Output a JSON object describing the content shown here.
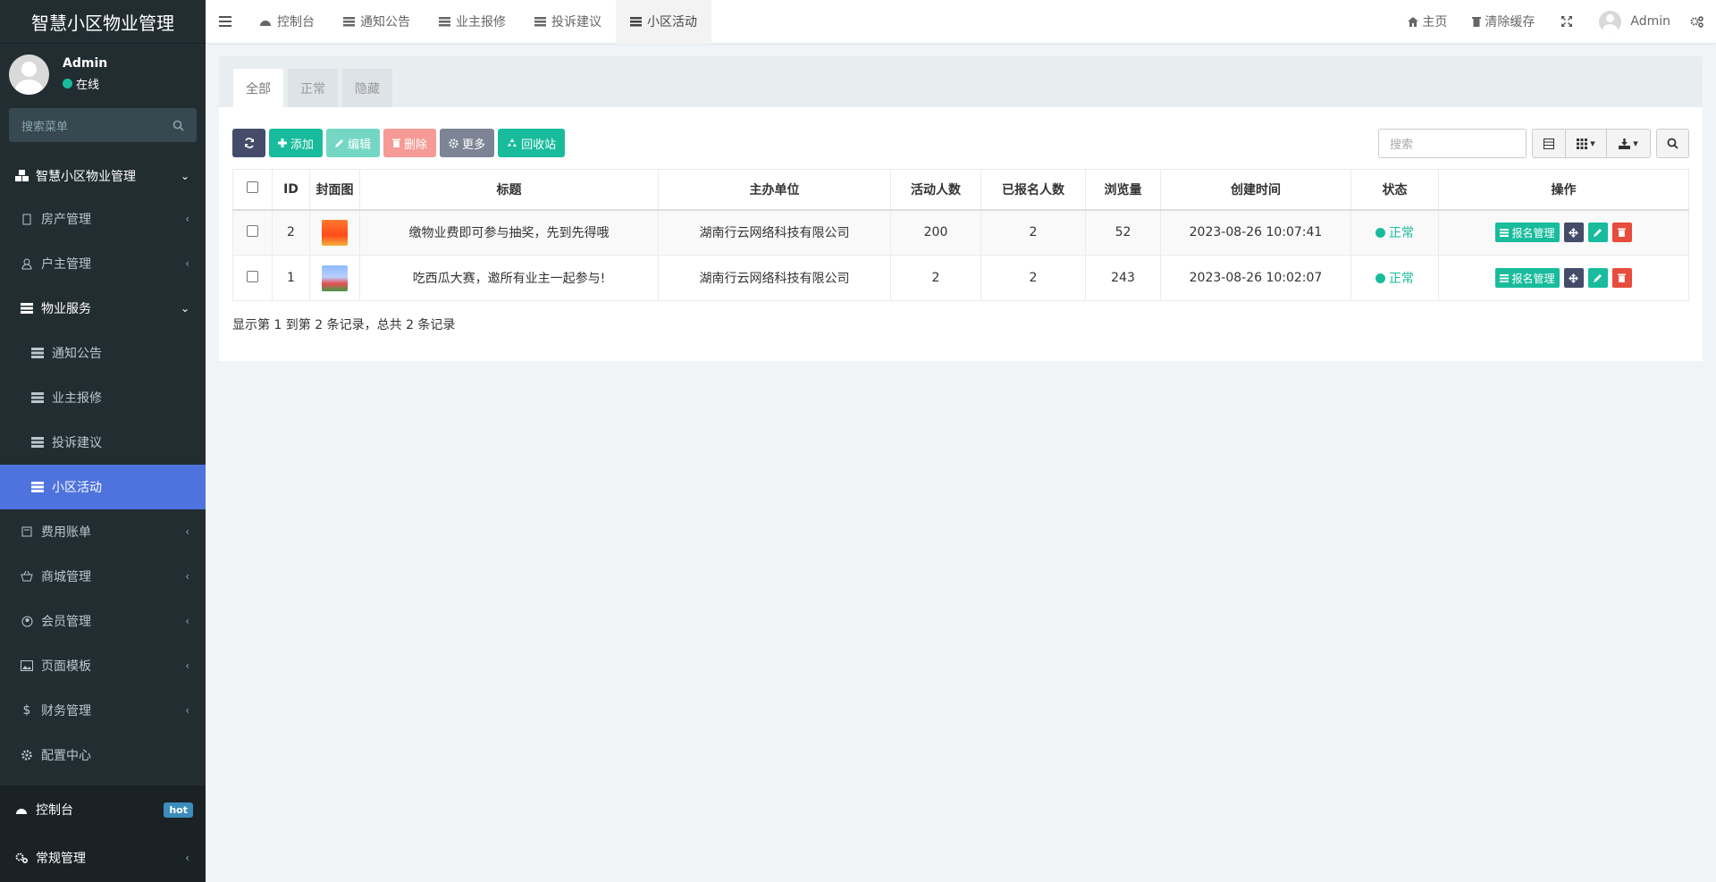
{
  "app": {
    "title": "智慧小区物业管理"
  },
  "user": {
    "name": "Admin",
    "status": "在线"
  },
  "sidebar": {
    "search_placeholder": "搜索菜单",
    "root_label": "智慧小区物业管理",
    "items": [
      {
        "label": "房产管理",
        "icon": "building-icon"
      },
      {
        "label": "户主管理",
        "icon": "user-icon"
      },
      {
        "label": "物业服务",
        "icon": "list-icon"
      },
      {
        "label": "通知公告",
        "icon": "list-icon"
      },
      {
        "label": "业主报修",
        "icon": "list-icon"
      },
      {
        "label": "投诉建议",
        "icon": "list-icon"
      },
      {
        "label": "小区活动",
        "icon": "list-icon"
      },
      {
        "label": "费用账单",
        "icon": "bill-icon"
      },
      {
        "label": "商城管理",
        "icon": "basket-icon"
      },
      {
        "label": "会员管理",
        "icon": "member-icon"
      },
      {
        "label": "页面模板",
        "icon": "image-icon"
      },
      {
        "label": "财务管理",
        "icon": "dollar-icon"
      },
      {
        "label": "配置中心",
        "icon": "gear-icon"
      }
    ],
    "bottom": [
      {
        "label": "控制台",
        "badge": "hot",
        "icon": "dashboard-icon"
      },
      {
        "label": "常规管理",
        "icon": "cogs-icon"
      }
    ]
  },
  "topnav": {
    "tabs": [
      {
        "label": "控制台",
        "icon": "dashboard-icon"
      },
      {
        "label": "通知公告",
        "icon": "list-icon"
      },
      {
        "label": "业主报修",
        "icon": "list-icon"
      },
      {
        "label": "投诉建议",
        "icon": "list-icon"
      },
      {
        "label": "小区活动",
        "icon": "list-icon",
        "active": true
      }
    ],
    "home": "主页",
    "clear_cache": "清除缓存",
    "user": "Admin"
  },
  "panel": {
    "tabs": [
      "全部",
      "正常",
      "隐藏"
    ],
    "toolbar": {
      "add": "添加",
      "edit": "编辑",
      "delete": "删除",
      "more": "更多",
      "recycle": "回收站"
    },
    "search_placeholder": "搜索"
  },
  "table": {
    "columns": [
      "ID",
      "封面图",
      "标题",
      "主办单位",
      "活动人数",
      "已报名人数",
      "浏览量",
      "创建时间",
      "状态",
      "操作"
    ],
    "rows": [
      {
        "id": "2",
        "title": "缴物业费即可参与抽奖，先到先得哦",
        "org": "湖南行云网络科技有限公司",
        "capacity": "200",
        "registered": "2",
        "views": "52",
        "created": "2023-08-26 10:07:41",
        "status": "正常",
        "reg_btn": "报名管理"
      },
      {
        "id": "1",
        "title": "吃西瓜大赛，邀所有业主一起参与!",
        "org": "湖南行云网络科技有限公司",
        "capacity": "2",
        "registered": "2",
        "views": "243",
        "created": "2023-08-26 10:02:07",
        "status": "正常",
        "reg_btn": "报名管理"
      }
    ],
    "summary": "显示第 1 到第 2 条记录，总共 2 条记录"
  },
  "colors": {
    "sidebar_bg": "#222d32",
    "active_menu": "#4e73df",
    "green": "#18bc9c",
    "red": "#e74c3c",
    "dark_btn": "#444c69"
  }
}
